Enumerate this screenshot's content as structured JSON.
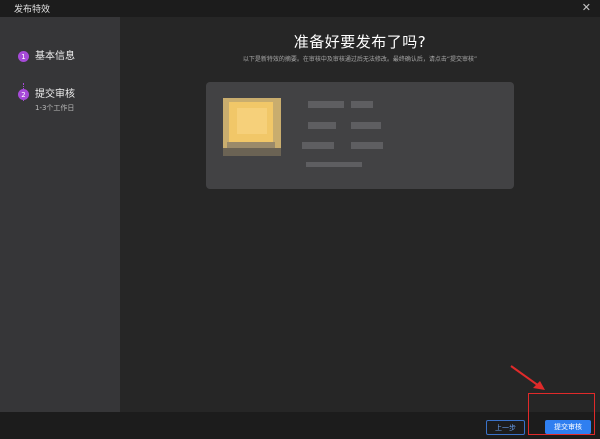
{
  "window": {
    "title": "发布特效",
    "close_glyph": "✕"
  },
  "sidebar": {
    "steps": [
      {
        "number": "1",
        "label": "基本信息"
      },
      {
        "number": "2",
        "label": "提交审核",
        "sublabel": "1-3个工作日"
      }
    ]
  },
  "main": {
    "heading": "准备好要发布了吗?",
    "description": "以下是新特效的摘要。在审核中及审核通过后无法修改。最终确认后，请点击“提交审核”"
  },
  "footer": {
    "prev_label": "上一步",
    "submit_label": "提交审核"
  },
  "colors": {
    "accent": "#a64ad8",
    "primary_button": "#2f7ff0",
    "annotation": "#e02a2a"
  }
}
